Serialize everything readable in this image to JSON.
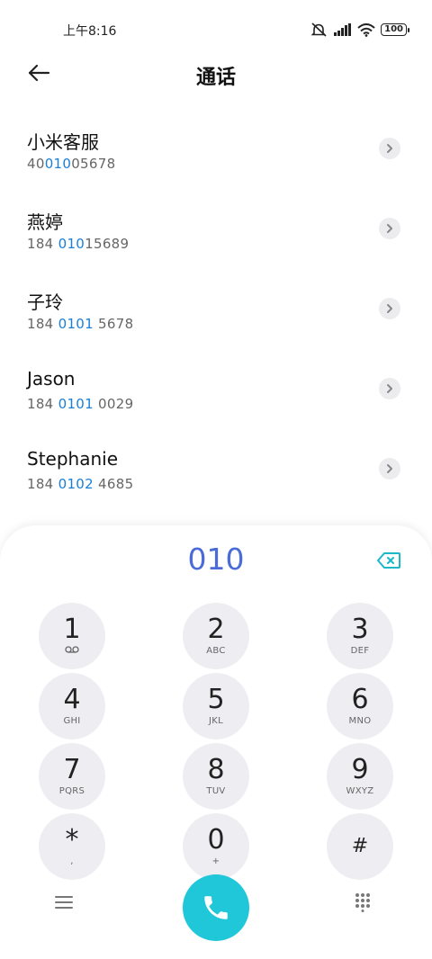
{
  "status_bar": {
    "time": "上午8:16",
    "battery": "100"
  },
  "header": {
    "title": "通话"
  },
  "contacts": [
    {
      "name": "小米客服",
      "number_pre": "40",
      "number_match": "010",
      "number_post": "05678"
    },
    {
      "name": "燕婷",
      "number_pre": "184 ",
      "number_match": "010",
      "number_post": "15689"
    },
    {
      "name": "子玲",
      "number_pre": "184 ",
      "number_match": "0101",
      "number_post": " 5678"
    },
    {
      "name": "Jason",
      "number_pre": "184 ",
      "number_match": "0101",
      "number_post": " 0029"
    },
    {
      "name": "Stephanie",
      "number_pre": "184 ",
      "number_match": "0102",
      "number_post": " 4685"
    }
  ],
  "dialpad": {
    "dialed": "010",
    "keys": [
      {
        "digit": "1",
        "sub": "voicemail-icon"
      },
      {
        "digit": "2",
        "sub": "ABC"
      },
      {
        "digit": "3",
        "sub": "DEF"
      },
      {
        "digit": "4",
        "sub": "GHI"
      },
      {
        "digit": "5",
        "sub": "JKL"
      },
      {
        "digit": "6",
        "sub": "MNO"
      },
      {
        "digit": "7",
        "sub": "PQRS"
      },
      {
        "digit": "8",
        "sub": "TUV"
      },
      {
        "digit": "9",
        "sub": "WXYZ"
      },
      {
        "digit": "*",
        "sub": ","
      },
      {
        "digit": "0",
        "sub": "+"
      },
      {
        "digit": "#",
        "sub": ""
      }
    ]
  },
  "colors": {
    "accent_blue": "#4a6bd8",
    "highlight": "#1a7fd6",
    "call_button": "#1fc7d9",
    "backspace": "#1cb8c9"
  }
}
